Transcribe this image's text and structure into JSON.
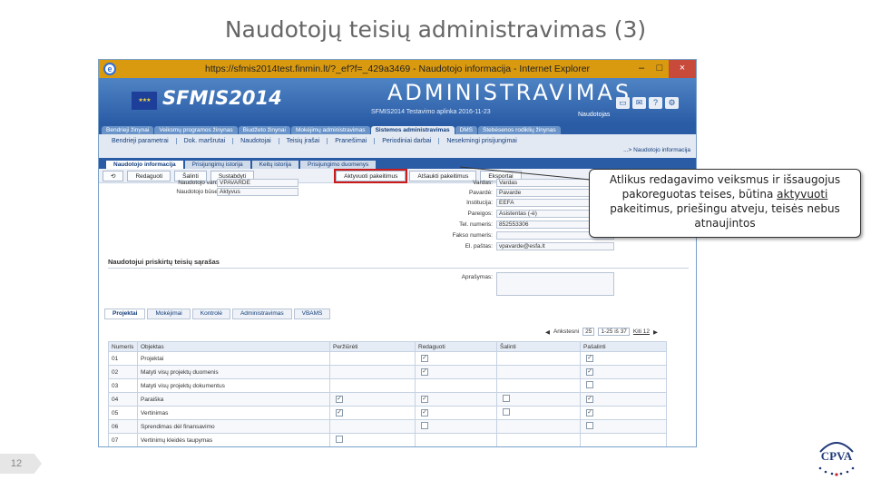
{
  "slide": {
    "title": "Naudotojų teisių administravimas (3)",
    "page_number": "12",
    "logo_text": "CPVA"
  },
  "window": {
    "title": "https://sfmis2014test.finmin.lt/?_ef?f=_429a3469 - Naudotojo informacija - Internet Explorer",
    "min": "–",
    "max": "□",
    "close": "×"
  },
  "banner": {
    "logo": "SFMIS2014",
    "section": "ADMINISTRAVIMAS",
    "environment": "SFMIS2014 Testavimo aplinka 2016-11-23",
    "user_link": "Naudotojas"
  },
  "main_tabs": [
    {
      "label": "Bendrieji žinynai",
      "active": false
    },
    {
      "label": "Veiksmų programos žinynas",
      "active": false
    },
    {
      "label": "Biudžeto žinynai",
      "active": false
    },
    {
      "label": "Mokėjimų administravimas",
      "active": false
    },
    {
      "label": "Sistemos administravimas",
      "active": true
    },
    {
      "label": "DMS",
      "active": false
    },
    {
      "label": "Stebėsenos rodiklių žinynas",
      "active": false
    }
  ],
  "submenu": [
    "Bendrieji parametrai",
    "Dok. maršrutai",
    "Naudotojai",
    "Teisių įrašai",
    "Pranešimai",
    "Periodiniai darbai",
    "Nesekmingi prisijungimai"
  ],
  "breadcrumb": "...> Naudotojo informacija",
  "inner_tabs": [
    {
      "label": "Naudotojo informacija",
      "active": true
    },
    {
      "label": "Prisijungimų istorija",
      "active": false
    },
    {
      "label": "Keitų istorija",
      "active": false
    },
    {
      "label": "Prisijungimo duomenys",
      "active": false
    }
  ],
  "toolbar": {
    "back": "⟲",
    "edit": "Redaguoti",
    "delete": "Šalinti",
    "renew": "Sustabdyti",
    "activate": "Aktyvuoti pakeitimus",
    "discard": "Atšaukti pakeitimus",
    "export": "Eksportai"
  },
  "user_form": {
    "username_label": "Naudotojo vardas:",
    "username_value": "VPAVARDE",
    "state_label": "Naudotojo būsena:",
    "state_value": "Aktyvus",
    "fields": [
      {
        "label": "Vardas:",
        "value": "Vardas"
      },
      {
        "label": "Pavardė:",
        "value": "Pavarde"
      },
      {
        "label": "Institucija:",
        "value": "EEFA"
      },
      {
        "label": "Pareigos:",
        "value": "Asistentas (-ė)"
      },
      {
        "label": "Tel. numeris:",
        "value": "852553306"
      },
      {
        "label": "Fakso numeris:",
        "value": ""
      },
      {
        "label": "El. paštas:",
        "value": "vpavarde@esfa.lt"
      }
    ],
    "rights_section": "Naudotojui priskirtų teisių sąrašas",
    "description_label": "Aprašymas:"
  },
  "lower_tabs": [
    {
      "label": "Projektai",
      "active": true
    },
    {
      "label": "Mokėjimai",
      "active": false
    },
    {
      "label": "Kontrolė",
      "active": false
    },
    {
      "label": "Administravimas",
      "active": false
    },
    {
      "label": "VBAMS",
      "active": false
    }
  ],
  "pager": {
    "prev": "Ankstesni",
    "page_size": "25",
    "range": "1-25 iš 37",
    "next": "Kiti 12"
  },
  "table": {
    "headers": [
      "Numeris",
      "Objektas",
      "Peržiūrėti",
      "Redaguoti",
      "Šalinti",
      "Pašalinti"
    ],
    "rows": [
      {
        "num": "01",
        "object": "Projektai",
        "checks": [
          false,
          true,
          false,
          true
        ],
        "show": [
          false,
          true,
          false,
          true
        ]
      },
      {
        "num": "02",
        "object": "Matyti visų projektų duomenis",
        "checks": [
          false,
          true,
          false,
          true
        ],
        "show": [
          false,
          true,
          false,
          true
        ]
      },
      {
        "num": "03",
        "object": "Matyti visų projektų dokumentus",
        "checks": [
          false,
          false,
          false,
          false
        ],
        "show": [
          false,
          false,
          false,
          true
        ]
      },
      {
        "num": "04",
        "object": "Paraiška",
        "checks": [
          true,
          true,
          false,
          true
        ],
        "show": [
          true,
          true,
          true,
          true
        ]
      },
      {
        "num": "05",
        "object": "Vertinimas",
        "checks": [
          true,
          true,
          false,
          true
        ],
        "show": [
          true,
          true,
          true,
          true
        ]
      },
      {
        "num": "06",
        "object": "Sprendimas dėl finansavimo",
        "checks": [
          false,
          false,
          false,
          false
        ],
        "show": [
          false,
          true,
          false,
          true
        ]
      },
      {
        "num": "07",
        "object": "Vertinimų kleidės taupymas",
        "checks": [
          false,
          false,
          false,
          false
        ],
        "show": [
          true,
          false,
          false,
          false
        ]
      }
    ]
  },
  "callout": {
    "text_before": "Atlikus redagavimo veiksmus ir išsaugojus pakoreguotas teises, būtina ",
    "text_underlined": "aktyvuoti",
    "text_after": " pakeitimus, priešingu atveju, teisės nebus atnaujintos"
  },
  "colors": {
    "titlebar": "#d99a10",
    "banner": "#2a5ca6",
    "highlight": "#cc1b1b"
  }
}
